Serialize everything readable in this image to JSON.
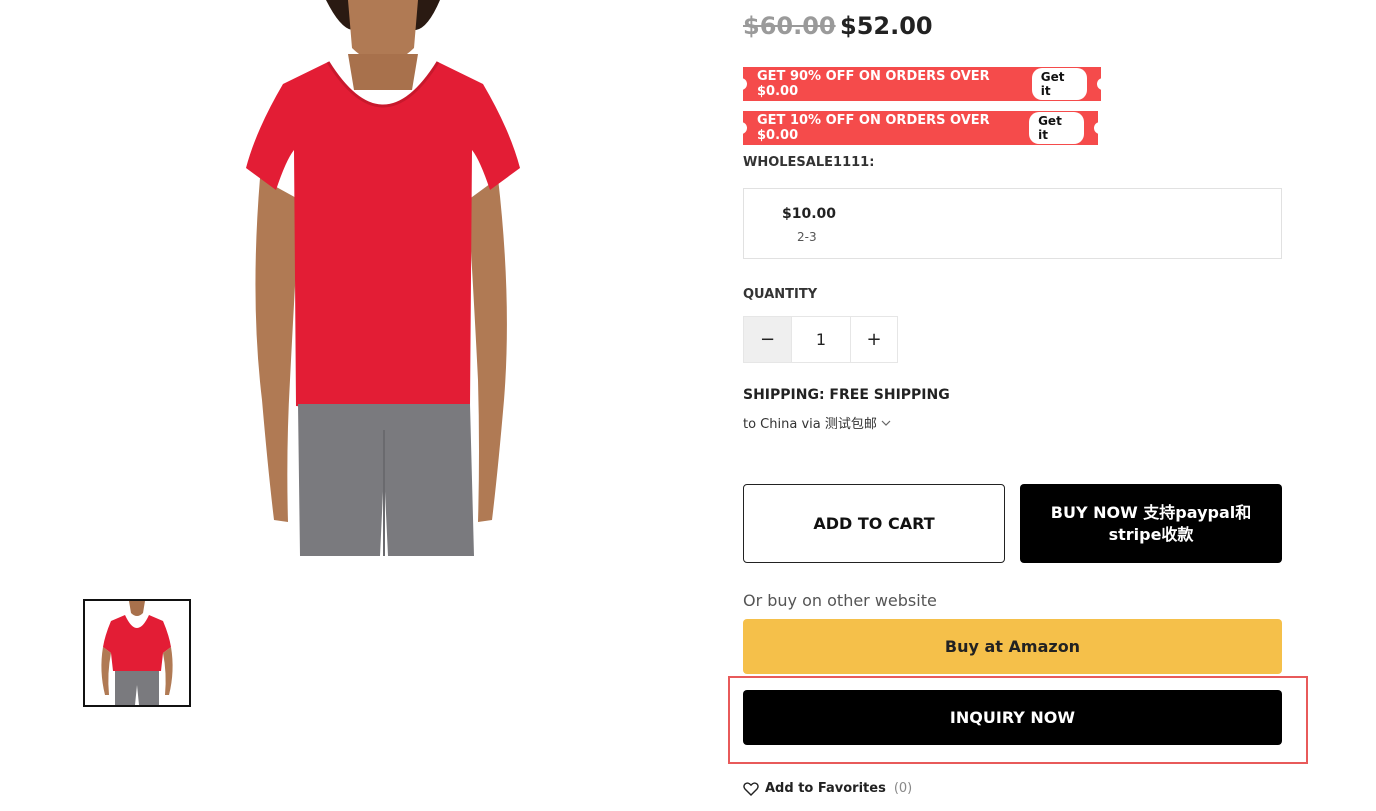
{
  "colors": {
    "coupon_bg": "#f54b4b",
    "amazon_bg": "#f5c04a",
    "primary_black": "#000000",
    "highlight_border": "#e85a5a"
  },
  "product": {
    "image_icon": "product-photo",
    "thumbnail_icon": "product-thumbnail"
  },
  "price": {
    "original": "$60.00",
    "current": "$52.00"
  },
  "coupons": [
    {
      "text": "GET 90% OFF ON ORDERS OVER $0.00",
      "action": "Get it"
    },
    {
      "text": "GET 10% OFF ON ORDERS OVER $0.00",
      "action": "Get it"
    }
  ],
  "wholesale": {
    "title": "WHOLESALE1111:",
    "tiers": [
      {
        "price": "$10.00",
        "range": "2-3"
      }
    ]
  },
  "quantity": {
    "label": "QUANTITY",
    "minus": "−",
    "value": "1",
    "plus": "+"
  },
  "shipping": {
    "title": "SHIPPING: FREE SHIPPING",
    "detail": "to China via 测试包邮"
  },
  "actions": {
    "add_to_cart": "ADD TO CART",
    "buy_now": "BUY NOW 支持paypal和stripe收款",
    "other_label": "Or buy on other website",
    "amazon": "Buy at Amazon",
    "inquiry": "INQUIRY NOW"
  },
  "favorites": {
    "label": "Add to Favorites",
    "count": "(0)"
  }
}
